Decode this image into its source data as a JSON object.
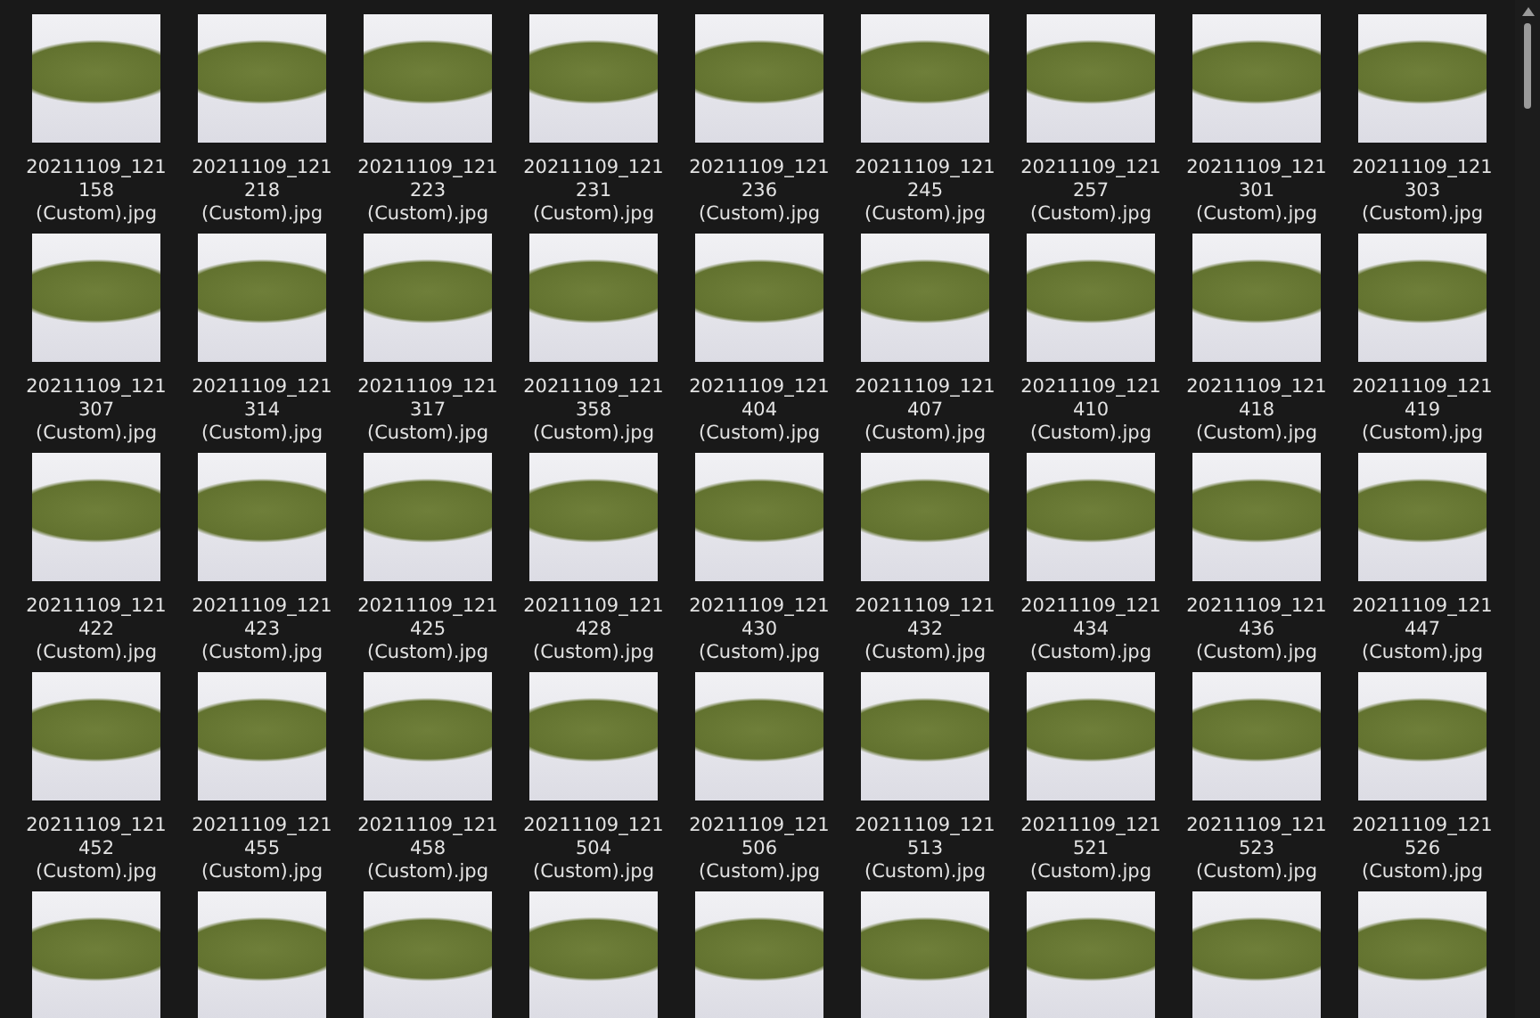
{
  "files": [
    {
      "kind": "file",
      "lines": [
        "20211109_121",
        "158",
        "(Custom).jpg"
      ]
    },
    {
      "kind": "file",
      "lines": [
        "20211109_121",
        "218",
        "(Custom).jpg"
      ]
    },
    {
      "kind": "file",
      "lines": [
        "20211109_121",
        "223",
        "(Custom).jpg"
      ]
    },
    {
      "kind": "file",
      "lines": [
        "20211109_121",
        "231",
        "(Custom).jpg"
      ]
    },
    {
      "kind": "file",
      "lines": [
        "20211109_121",
        "236",
        "(Custom).jpg"
      ]
    },
    {
      "kind": "file",
      "lines": [
        "20211109_121",
        "245",
        "(Custom).jpg"
      ]
    },
    {
      "kind": "file",
      "lines": [
        "20211109_121",
        "257",
        "(Custom).jpg"
      ]
    },
    {
      "kind": "file",
      "lines": [
        "20211109_121",
        "301",
        "(Custom).jpg"
      ]
    },
    {
      "kind": "file",
      "lines": [
        "20211109_121",
        "303",
        "(Custom).jpg"
      ]
    },
    {
      "kind": "file",
      "lines": [
        "20211109_121",
        "307",
        "(Custom).jpg"
      ]
    },
    {
      "kind": "file",
      "lines": [
        "20211109_121",
        "314",
        "(Custom).jpg"
      ]
    },
    {
      "kind": "file",
      "lines": [
        "20211109_121",
        "317",
        "(Custom).jpg"
      ]
    },
    {
      "kind": "file",
      "lines": [
        "20211109_121",
        "358",
        "(Custom).jpg"
      ]
    },
    {
      "kind": "file",
      "lines": [
        "20211109_121",
        "404",
        "(Custom).jpg"
      ]
    },
    {
      "kind": "file",
      "lines": [
        "20211109_121",
        "407",
        "(Custom).jpg"
      ]
    },
    {
      "kind": "file",
      "lines": [
        "20211109_121",
        "410",
        "(Custom).jpg"
      ]
    },
    {
      "kind": "file",
      "lines": [
        "20211109_121",
        "418",
        "(Custom).jpg"
      ]
    },
    {
      "kind": "file",
      "lines": [
        "20211109_121",
        "419",
        "(Custom).jpg"
      ]
    },
    {
      "kind": "file",
      "lines": [
        "20211109_121",
        "422",
        "(Custom).jpg"
      ]
    },
    {
      "kind": "file",
      "lines": [
        "20211109_121",
        "423",
        "(Custom).jpg"
      ]
    },
    {
      "kind": "file",
      "lines": [
        "20211109_121",
        "425",
        "(Custom).jpg"
      ]
    },
    {
      "kind": "file",
      "lines": [
        "20211109_121",
        "428",
        "(Custom).jpg"
      ]
    },
    {
      "kind": "file",
      "lines": [
        "20211109_121",
        "430",
        "(Custom).jpg"
      ]
    },
    {
      "kind": "file",
      "lines": [
        "20211109_121",
        "432",
        "(Custom).jpg"
      ]
    },
    {
      "kind": "file",
      "lines": [
        "20211109_121",
        "434",
        "(Custom).jpg"
      ]
    },
    {
      "kind": "file",
      "lines": [
        "20211109_121",
        "436",
        "(Custom).jpg"
      ]
    },
    {
      "kind": "file",
      "lines": [
        "20211109_121",
        "447",
        "(Custom).jpg"
      ]
    },
    {
      "kind": "file",
      "lines": [
        "20211109_121",
        "452",
        "(Custom).jpg"
      ]
    },
    {
      "kind": "file",
      "lines": [
        "20211109_121",
        "455",
        "(Custom).jpg"
      ]
    },
    {
      "kind": "file",
      "lines": [
        "20211109_121",
        "458",
        "(Custom).jpg"
      ]
    },
    {
      "kind": "file",
      "lines": [
        "20211109_121",
        "504",
        "(Custom).jpg"
      ]
    },
    {
      "kind": "file",
      "lines": [
        "20211109_121",
        "506",
        "(Custom).jpg"
      ]
    },
    {
      "kind": "file",
      "lines": [
        "20211109_121",
        "513",
        "(Custom).jpg"
      ]
    },
    {
      "kind": "file",
      "lines": [
        "20211109_121",
        "521",
        "(Custom).jpg"
      ]
    },
    {
      "kind": "file",
      "lines": [
        "20211109_121",
        "523",
        "(Custom).jpg"
      ]
    },
    {
      "kind": "file",
      "lines": [
        "20211109_121",
        "526",
        "(Custom).jpg"
      ]
    },
    {
      "kind": "thumbnail-only"
    },
    {
      "kind": "thumbnail-only"
    },
    {
      "kind": "thumbnail-only"
    },
    {
      "kind": "thumbnail-only"
    },
    {
      "kind": "thumbnail-only"
    },
    {
      "kind": "thumbnail-only"
    },
    {
      "kind": "thumbnail-only"
    },
    {
      "kind": "thumbnail-only"
    },
    {
      "kind": "thumbnail-only"
    }
  ]
}
